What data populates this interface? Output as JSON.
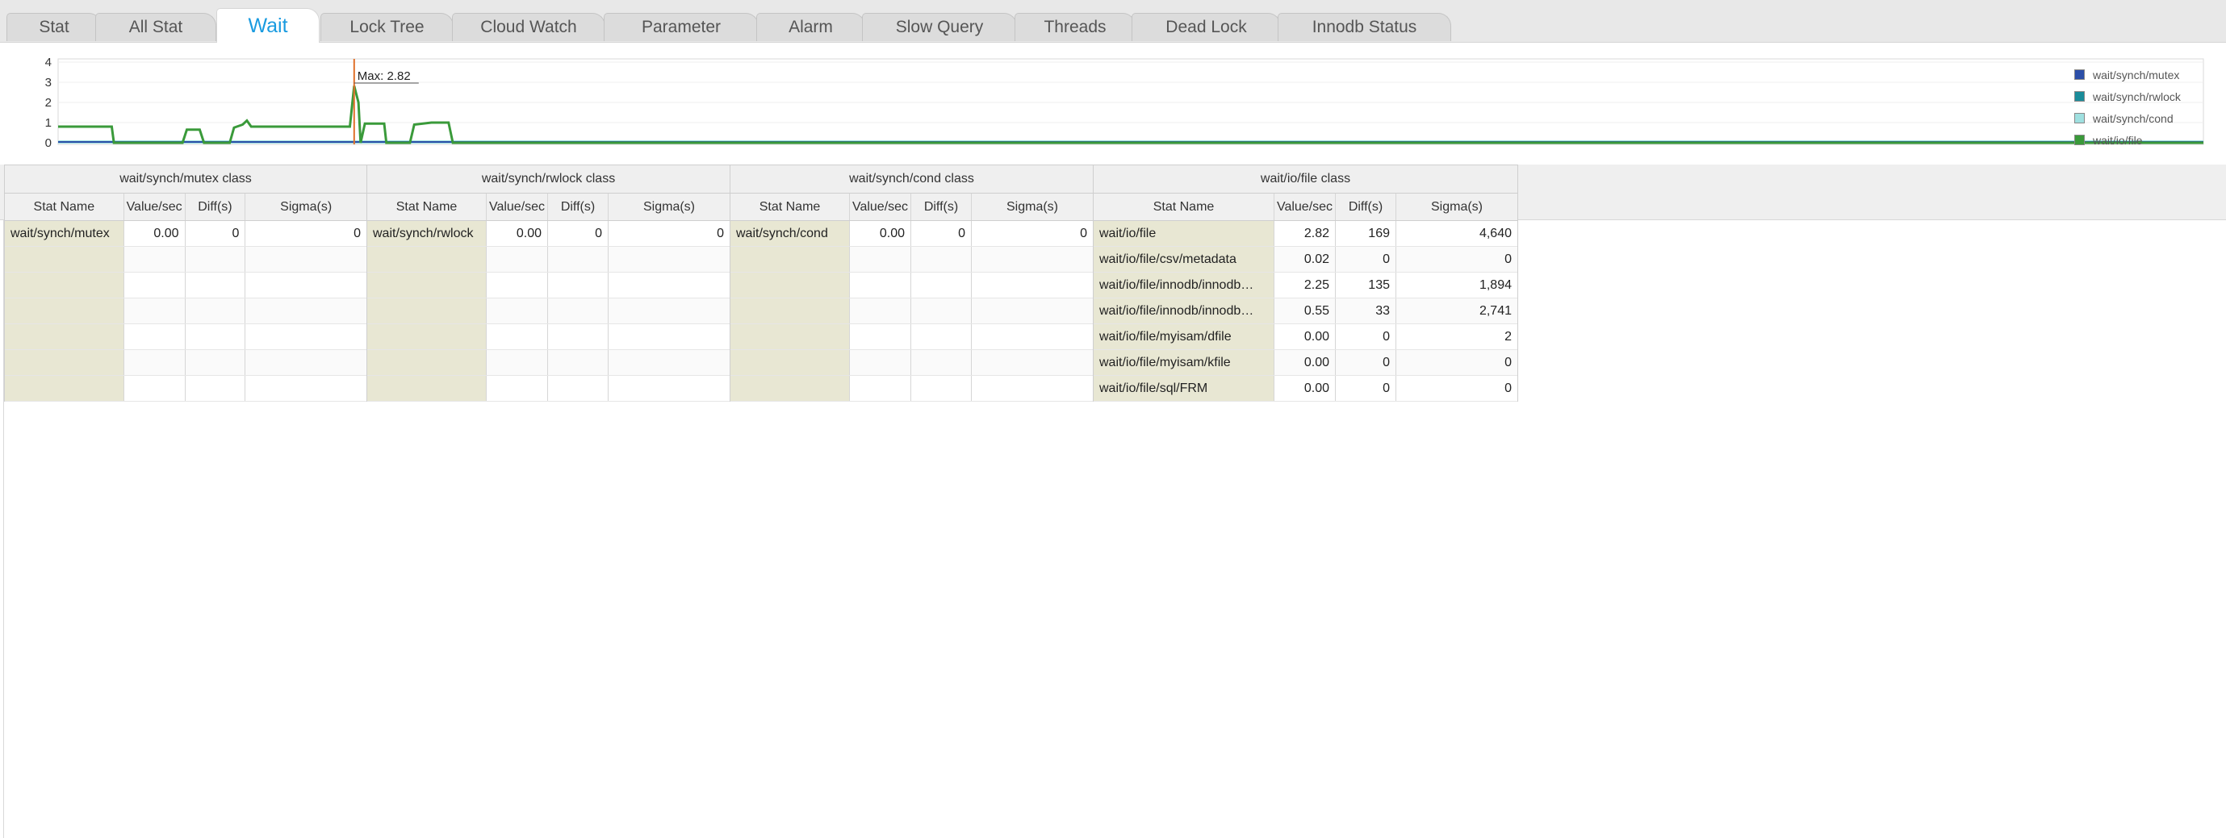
{
  "tabs": [
    {
      "label": "Stat",
      "active": false
    },
    {
      "label": "All Stat",
      "active": false
    },
    {
      "label": "Wait",
      "active": true
    },
    {
      "label": "Lock Tree",
      "active": false
    },
    {
      "label": "Cloud Watch",
      "active": false
    },
    {
      "label": "Parameter",
      "active": false
    },
    {
      "label": "Alarm",
      "active": false
    },
    {
      "label": "Slow Query",
      "active": false
    },
    {
      "label": "Threads",
      "active": false
    },
    {
      "label": "Dead Lock",
      "active": false
    },
    {
      "label": "Innodb Status",
      "active": false
    }
  ],
  "chart": {
    "max_label": "Max:  2.82",
    "y_ticks": [
      "0",
      "1",
      "2",
      "3",
      "4"
    ],
    "legend": [
      {
        "name": "wait/synch/mutex",
        "color": "#2c4fa8"
      },
      {
        "name": "wait/synch/rwlock",
        "color": "#1a8c9a"
      },
      {
        "name": "wait/synch/cond",
        "color": "#9fe0e0"
      },
      {
        "name": "wait/io/file",
        "color": "#3a9a3a"
      }
    ]
  },
  "chart_data": {
    "type": "line",
    "ylim": [
      0,
      4
    ],
    "series": [
      {
        "name": "wait/synch/mutex",
        "values": [
          [
            0,
            0
          ],
          [
            1,
            0
          ]
        ]
      },
      {
        "name": "wait/synch/rwlock",
        "values": [
          [
            0,
            0
          ],
          [
            1,
            0
          ]
        ]
      },
      {
        "name": "wait/synch/cond",
        "values": [
          [
            0,
            0
          ],
          [
            1,
            0
          ]
        ]
      },
      {
        "name": "wait/io/file",
        "values": [
          [
            0.0,
            0.8
          ],
          [
            0.025,
            0.8
          ],
          [
            0.026,
            0.0
          ],
          [
            0.058,
            0.0
          ],
          [
            0.06,
            0.65
          ],
          [
            0.066,
            0.65
          ],
          [
            0.068,
            0.0
          ],
          [
            0.08,
            0.0
          ],
          [
            0.082,
            0.75
          ],
          [
            0.086,
            0.9
          ],
          [
            0.088,
            1.1
          ],
          [
            0.09,
            0.8
          ],
          [
            0.136,
            0.8
          ],
          [
            0.138,
            2.82
          ],
          [
            0.14,
            2.0
          ],
          [
            0.141,
            0.0
          ],
          [
            0.143,
            0.95
          ],
          [
            0.152,
            0.95
          ],
          [
            0.153,
            0.0
          ],
          [
            0.164,
            0.0
          ],
          [
            0.166,
            0.9
          ],
          [
            0.174,
            1.0
          ],
          [
            0.182,
            1.0
          ],
          [
            0.184,
            0.0
          ],
          [
            1.0,
            0.0
          ]
        ]
      }
    ]
  },
  "headers": {
    "stat_name": "Stat Name",
    "value": "Value/sec",
    "diff": "Diff(s)",
    "sigma": "Sigma(s)"
  },
  "panels": [
    {
      "title": "wait/synch/mutex class",
      "rows": [
        {
          "name": "wait/synch/mutex",
          "value": "0.00",
          "diff": "0",
          "sigma": "0"
        },
        {
          "name": "",
          "value": "",
          "diff": "",
          "sigma": ""
        },
        {
          "name": "",
          "value": "",
          "diff": "",
          "sigma": ""
        },
        {
          "name": "",
          "value": "",
          "diff": "",
          "sigma": ""
        },
        {
          "name": "",
          "value": "",
          "diff": "",
          "sigma": ""
        },
        {
          "name": "",
          "value": "",
          "diff": "",
          "sigma": ""
        },
        {
          "name": "",
          "value": "",
          "diff": "",
          "sigma": ""
        }
      ]
    },
    {
      "title": "wait/synch/rwlock class",
      "rows": [
        {
          "name": "wait/synch/rwlock",
          "value": "0.00",
          "diff": "0",
          "sigma": "0"
        },
        {
          "name": "",
          "value": "",
          "diff": "",
          "sigma": ""
        },
        {
          "name": "",
          "value": "",
          "diff": "",
          "sigma": ""
        },
        {
          "name": "",
          "value": "",
          "diff": "",
          "sigma": ""
        },
        {
          "name": "",
          "value": "",
          "diff": "",
          "sigma": ""
        },
        {
          "name": "",
          "value": "",
          "diff": "",
          "sigma": ""
        },
        {
          "name": "",
          "value": "",
          "diff": "",
          "sigma": ""
        }
      ]
    },
    {
      "title": "wait/synch/cond class",
      "rows": [
        {
          "name": "wait/synch/cond",
          "value": "0.00",
          "diff": "0",
          "sigma": "0"
        },
        {
          "name": "",
          "value": "",
          "diff": "",
          "sigma": ""
        },
        {
          "name": "",
          "value": "",
          "diff": "",
          "sigma": ""
        },
        {
          "name": "",
          "value": "",
          "diff": "",
          "sigma": ""
        },
        {
          "name": "",
          "value": "",
          "diff": "",
          "sigma": ""
        },
        {
          "name": "",
          "value": "",
          "diff": "",
          "sigma": ""
        },
        {
          "name": "",
          "value": "",
          "diff": "",
          "sigma": ""
        }
      ]
    },
    {
      "title": "wait/io/file class",
      "rows": [
        {
          "name": "wait/io/file",
          "value": "2.82",
          "diff": "169",
          "sigma": "4,640"
        },
        {
          "name": "wait/io/file/csv/metadata",
          "value": "0.02",
          "diff": "0",
          "sigma": "0"
        },
        {
          "name": "wait/io/file/innodb/innodb…",
          "value": "2.25",
          "diff": "135",
          "sigma": "1,894"
        },
        {
          "name": "wait/io/file/innodb/innodb…",
          "value": "0.55",
          "diff": "33",
          "sigma": "2,741"
        },
        {
          "name": "wait/io/file/myisam/dfile",
          "value": "0.00",
          "diff": "0",
          "sigma": "2"
        },
        {
          "name": "wait/io/file/myisam/kfile",
          "value": "0.00",
          "diff": "0",
          "sigma": "0"
        },
        {
          "name": "wait/io/file/sql/FRM",
          "value": "0.00",
          "diff": "0",
          "sigma": "0"
        }
      ]
    }
  ]
}
